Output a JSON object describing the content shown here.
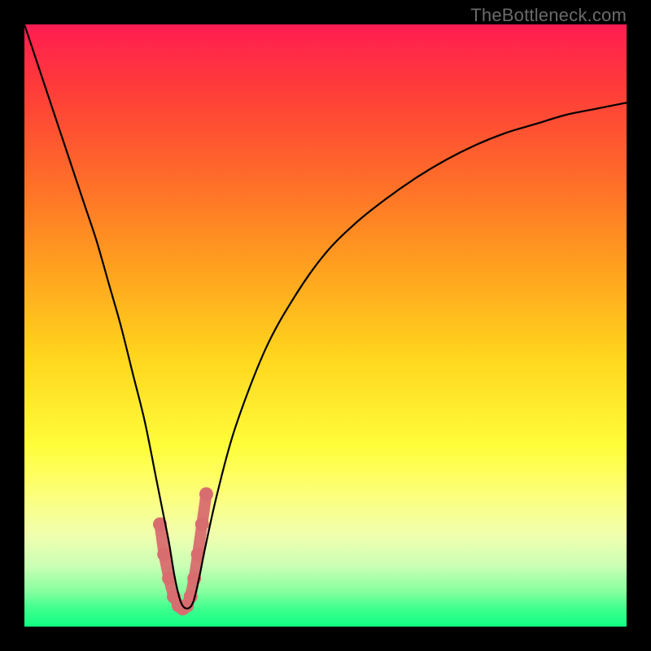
{
  "watermark": "TheBottleneck.com",
  "chart_data": {
    "type": "line",
    "title": "",
    "xlabel": "",
    "ylabel": "",
    "xlim": [
      0,
      100
    ],
    "ylim": [
      0,
      100
    ],
    "grid": false,
    "series": [
      {
        "name": "curve",
        "color": "#000000",
        "x": [
          0,
          2,
          4,
          6,
          8,
          10,
          12,
          14,
          16,
          18,
          20,
          22,
          23,
          24,
          25,
          26,
          27,
          28,
          29,
          30,
          32,
          35,
          40,
          45,
          50,
          55,
          60,
          65,
          70,
          75,
          80,
          85,
          90,
          95,
          100
        ],
        "y": [
          100,
          94,
          88,
          82,
          76,
          70,
          64,
          57,
          50,
          42,
          34,
          24,
          19,
          14,
          8,
          4,
          3,
          4,
          8,
          13,
          22,
          33,
          46,
          55,
          62,
          67,
          71,
          74.5,
          77.5,
          80,
          82,
          83.5,
          85,
          86,
          87
        ]
      },
      {
        "name": "trough-marker",
        "color": "#d86d6f",
        "x": [
          22.5,
          23.2,
          24.0,
          24.8,
          25.6,
          26.3,
          27.0,
          27.6,
          28.2,
          28.8,
          29.5,
          30.2
        ],
        "y": [
          17,
          12,
          8,
          5,
          3.5,
          3,
          3.5,
          5,
          8,
          12,
          17,
          22
        ]
      }
    ],
    "gradient_stops": [
      {
        "offset": 0.0,
        "color": "#ff1d52"
      },
      {
        "offset": 0.1,
        "color": "#ff3a3a"
      },
      {
        "offset": 0.25,
        "color": "#ff6a2a"
      },
      {
        "offset": 0.4,
        "color": "#ff9f1f"
      },
      {
        "offset": 0.55,
        "color": "#ffd51e"
      },
      {
        "offset": 0.7,
        "color": "#fffd3a"
      },
      {
        "offset": 0.78,
        "color": "#fdff7a"
      },
      {
        "offset": 0.85,
        "color": "#f0ffb0"
      },
      {
        "offset": 0.9,
        "color": "#c9ffb4"
      },
      {
        "offset": 0.94,
        "color": "#8affa0"
      },
      {
        "offset": 0.97,
        "color": "#3fff8e"
      },
      {
        "offset": 1.0,
        "color": "#10ff84"
      }
    ]
  }
}
